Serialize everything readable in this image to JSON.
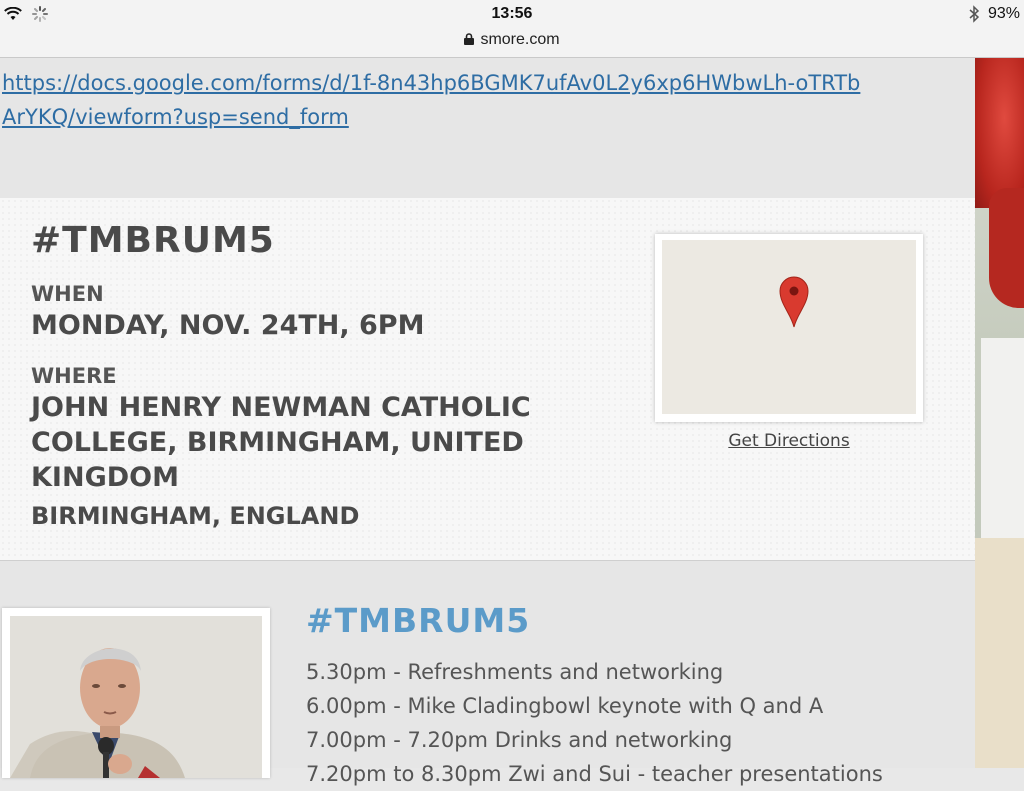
{
  "status_bar": {
    "time": "13:56",
    "url": "smore.com",
    "battery": "93%",
    "icons": [
      "wifi-icon",
      "activity-spinner-icon",
      "bluetooth-icon",
      "lock-icon"
    ]
  },
  "form_link": {
    "text": "https://docs.google.com/forms/d/1f-8n43hp6BGMK7ufAv0L2y6xp6HWbwLh-oTRTbArYKQ/viewform?usp=send_form"
  },
  "event": {
    "title": "#TMBRUM5",
    "when_label": "WHEN",
    "when_value": "MONDAY, NOV. 24TH, 6PM",
    "where_label": "WHERE",
    "where_value": "JOHN HENRY NEWMAN CATHOLIC COLLEGE, BIRMINGHAM, UNITED KINGDOM",
    "city": "BIRMINGHAM, ENGLAND",
    "get_directions": "Get Directions"
  },
  "agenda_section": {
    "title": "#TMBRUM5",
    "items": [
      "5.30pm - Refreshments and networking",
      "6.00pm - Mike Cladingbowl keynote with Q and A",
      "7.00pm - 7.20pm Drinks and networking",
      "7.20pm to 8.30pm Zwi and Sui - teacher presentations"
    ]
  },
  "colors": {
    "link": "#2e6da4",
    "heading_blue": "#5b9bc9",
    "text_dark": "#4a4a4a",
    "pin_red": "#d93a2f"
  }
}
